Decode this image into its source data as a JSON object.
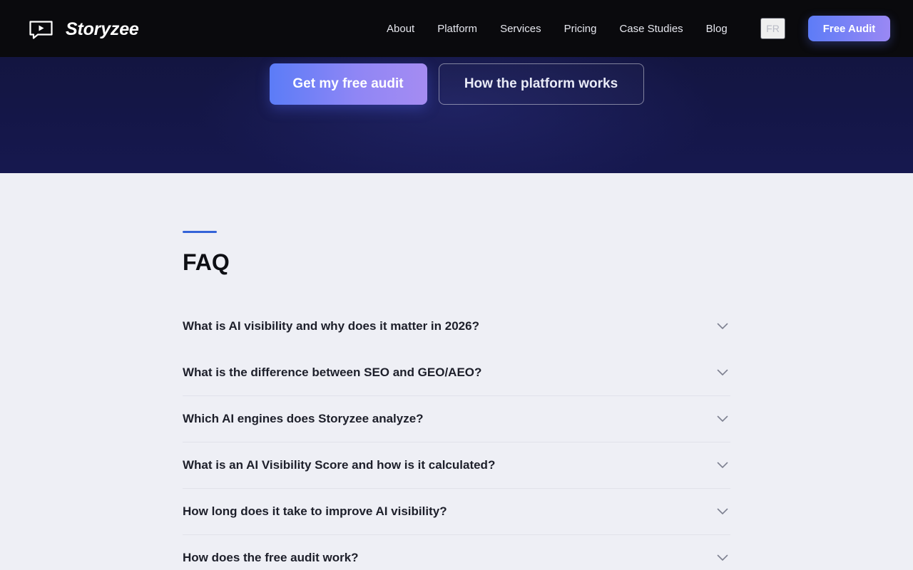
{
  "brand": {
    "name": "Storyzee",
    "logo_icon": "play-screen-icon"
  },
  "nav": {
    "links": [
      "About",
      "Platform",
      "Services",
      "Pricing",
      "Case Studies",
      "Blog"
    ],
    "language": "FR",
    "cta": "Free Audit"
  },
  "hero": {
    "primary_cta": "Get my free audit",
    "secondary_cta": "How the platform works"
  },
  "faq": {
    "title": "FAQ",
    "items": [
      {
        "question": "What is AI visibility and why does it matter in 2026?",
        "icon": "chevron-down-icon"
      },
      {
        "question": "What is the difference between SEO and GEO/AEO?",
        "icon": "chevron-down-icon"
      },
      {
        "question": "Which AI engines does Storyzee analyze?",
        "icon": "chevron-down-icon"
      },
      {
        "question": "What is an AI Visibility Score and how is it calculated?",
        "icon": "chevron-down-icon"
      },
      {
        "question": "How long does it take to improve AI visibility?",
        "icon": "chevron-down-icon"
      },
      {
        "question": "How does the free audit work?",
        "icon": "chevron-down-icon"
      }
    ]
  },
  "colors": {
    "accent": "#3463d8",
    "cta_gradient_start": "#5b7cf7",
    "cta_gradient_end": "#a58cf2",
    "nav_background": "#0a0a0d",
    "hero_background": "#141646",
    "page_background": "#eeeff5"
  }
}
